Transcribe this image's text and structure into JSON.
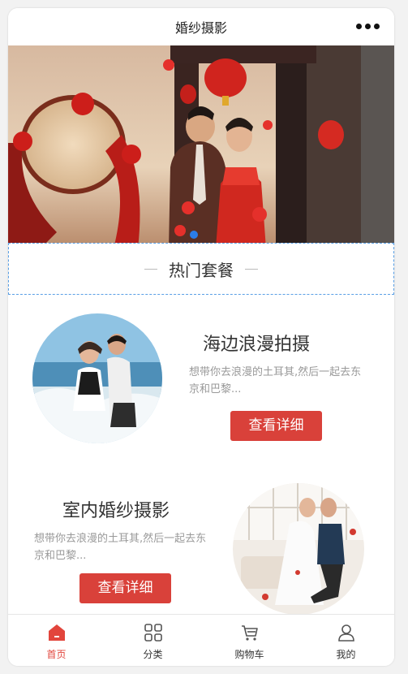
{
  "header": {
    "title": "婚纱摄影",
    "menu_icon": "more-dots-icon"
  },
  "banner": {
    "icon": "wedding-couple-photo",
    "active_slide": 1,
    "slide_count": 1
  },
  "section": {
    "title": "热门套餐"
  },
  "packages": [
    {
      "title": "海边浪漫拍摄",
      "desc": "想带你去浪漫的土耳其,然后一起去东京和巴黎...",
      "button": "查看详细",
      "image": "beach-couple-photo"
    },
    {
      "title": "室内婚纱摄影",
      "desc": "想带你去浪漫的土耳其,然后一起去东京和巴黎...",
      "button": "查看详细",
      "image": "indoor-couple-photo"
    }
  ],
  "tabbar": {
    "active_color": "#e2453c",
    "items": [
      {
        "label": "首页",
        "icon": "home-icon",
        "active": true
      },
      {
        "label": "分类",
        "icon": "category-grid-icon",
        "active": false
      },
      {
        "label": "购物车",
        "icon": "cart-icon",
        "active": false
      },
      {
        "label": "我的",
        "icon": "user-icon",
        "active": false
      }
    ]
  },
  "colors": {
    "button_red": "#d9413a",
    "dot_blue": "#2b7de9"
  }
}
